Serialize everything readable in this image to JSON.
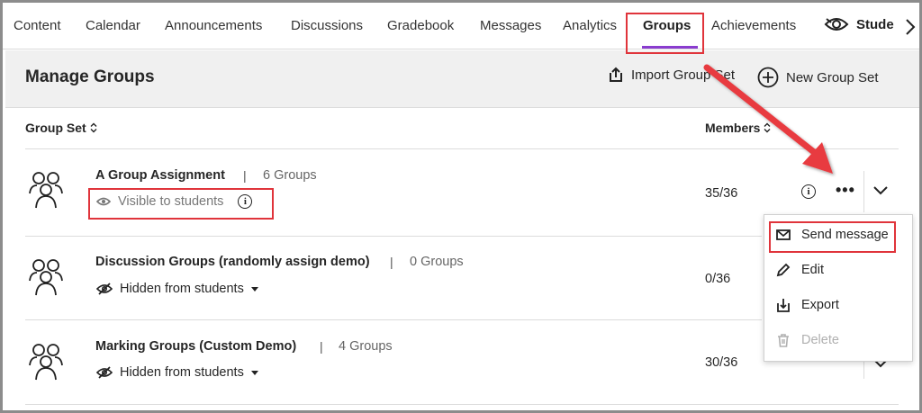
{
  "nav": {
    "tabs": [
      "Content",
      "Calendar",
      "Announcements",
      "Discussions",
      "Gradebook",
      "Messages",
      "Analytics",
      "Groups",
      "Achievements"
    ],
    "active_tab": "Groups",
    "student_view_label": "Stude"
  },
  "header": {
    "title": "Manage Groups",
    "import_label": "Import Group Set",
    "new_label": "New Group Set"
  },
  "columns": {
    "group_set": "Group Set",
    "members": "Members"
  },
  "rows": [
    {
      "name": "A Group Assignment",
      "separator": "|",
      "count": "6 Groups",
      "visibility": "Visible to students",
      "members": "35/36"
    },
    {
      "name": "Discussion Groups (randomly assign demo)",
      "separator": "|",
      "count": "0 Groups",
      "visibility": "Hidden from students",
      "members": "0/36"
    },
    {
      "name": "Marking Groups (Custom Demo)",
      "separator": "|",
      "count": "4 Groups",
      "visibility": "Hidden from students",
      "members": "30/36"
    }
  ],
  "menu": {
    "items": [
      "Send message",
      "Edit",
      "Export",
      "Delete"
    ],
    "disabled": [
      "Delete"
    ]
  },
  "colors": {
    "accent_purple": "#8a3ccf",
    "callout_red": "#e0343b",
    "header_band": "#f0f0f0"
  },
  "icons": [
    "view-eye-icon",
    "chevron-right-icon",
    "import-icon",
    "plus-circle-icon",
    "sort-icon",
    "group-people-icon",
    "eye-icon",
    "eye-slash-icon",
    "caret-down-icon",
    "info-icon",
    "more-icon",
    "chevron-down-icon",
    "envelope-icon",
    "pencil-icon",
    "export-icon",
    "trash-icon"
  ]
}
